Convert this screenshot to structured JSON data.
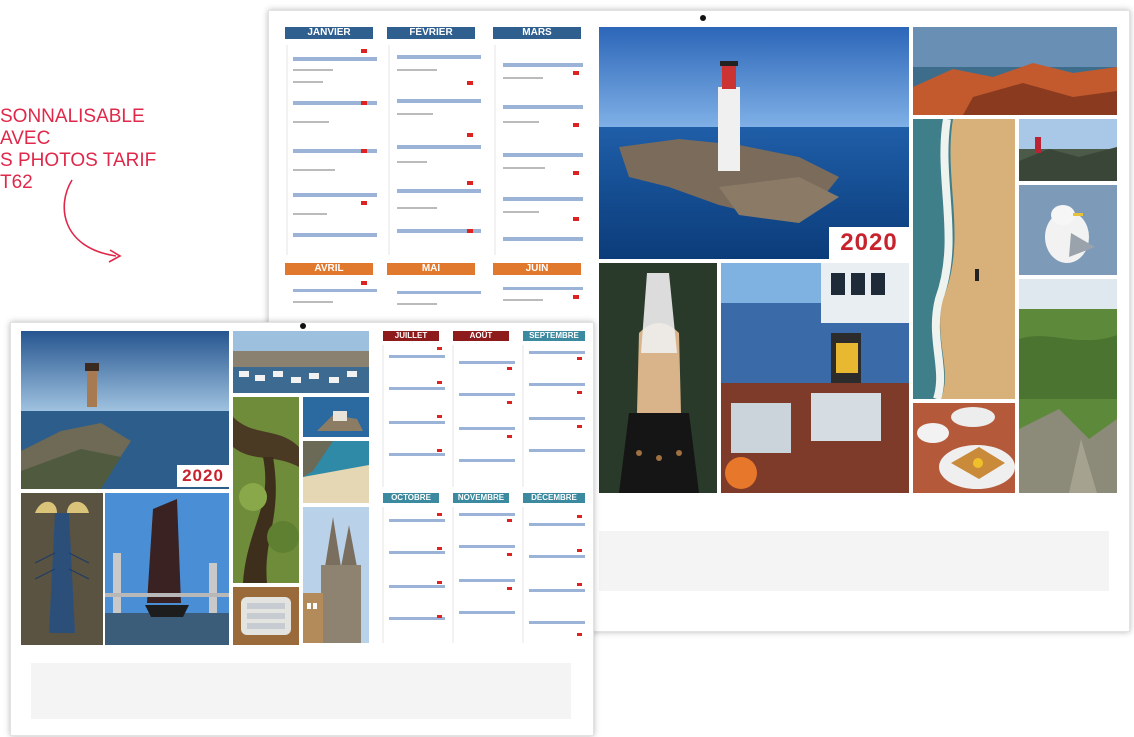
{
  "caption": {
    "line1": "SONNALISABLE AVEC",
    "line2": "S PHOTOS TARIF T62",
    "color": "#e0284a"
  },
  "back_calendar": {
    "year": "2020",
    "months": [
      "JANVIER",
      "FÉVRIER",
      "MARS",
      "AVRIL",
      "MAI",
      "JUIN"
    ],
    "photos": [
      "lighthouse-on-rocks",
      "pink-granite-coast",
      "beach-surfer",
      "hiker",
      "seagull",
      "heathland",
      "breton-headdress",
      "fishing-boat-crew",
      "crepes"
    ]
  },
  "front_calendar": {
    "year": "2020",
    "months": [
      "JUILLET",
      "AOÛT",
      "SEPTEMBRE",
      "OCTOBRE",
      "NOVEMBRE",
      "DÉCEMBRE"
    ],
    "photos": [
      "lighthouse-coast",
      "harbour",
      "small-island-house",
      "twisted-tree",
      "beach-cove",
      "lobster",
      "sailboat-bridge",
      "sardine-can",
      "cathedral-town"
    ]
  },
  "colors": {
    "year_red": "#c8232c",
    "year_blue": "#1f4f91",
    "header_blue": "#2f5f8f",
    "header_orange": "#e0782e",
    "header_red": "#8e1b1b",
    "header_teal": "#3c8aa0"
  }
}
